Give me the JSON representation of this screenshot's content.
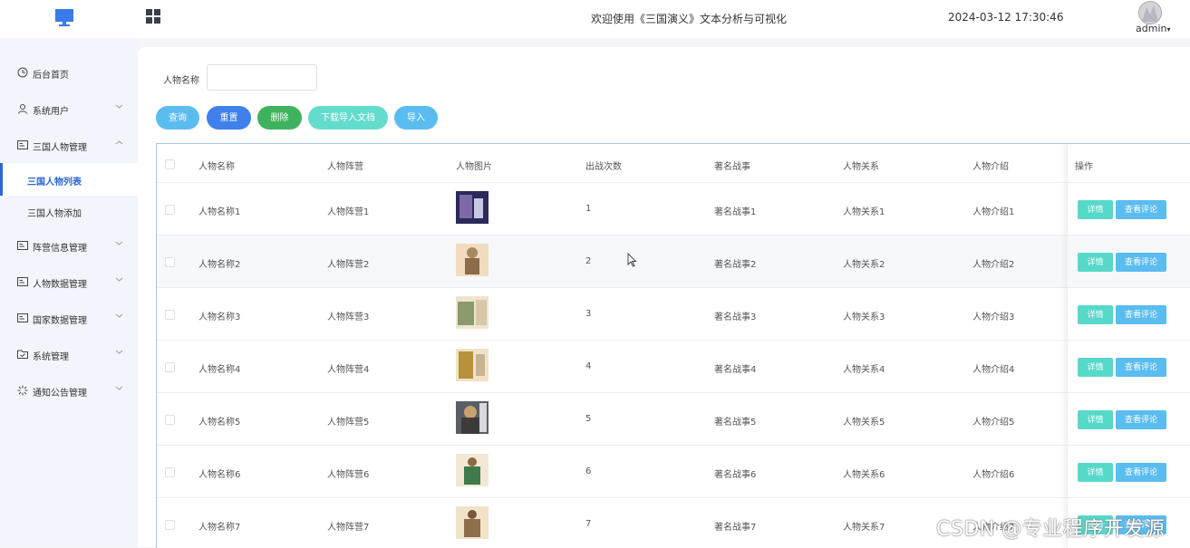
{
  "header": {
    "logo_icon": "monitor-icon",
    "menu_icon": "grid-icon",
    "title": "欢迎使用《三国演义》文本分析与可视化",
    "datetime": "2024-03-12 17:30:46",
    "user": "admin"
  },
  "sidebar": {
    "items": [
      {
        "label": "后台首页",
        "icon": "clock-icon"
      },
      {
        "label": "系统用户",
        "icon": "user-icon"
      },
      {
        "label": "三国人物管理",
        "icon": "card-icon"
      },
      {
        "label": "三国人物列表",
        "active": true
      },
      {
        "label": "三国人物添加"
      },
      {
        "label": "阵营信息管理",
        "icon": "card-icon"
      },
      {
        "label": "人物数据管理",
        "icon": "card-icon"
      },
      {
        "label": "国家数据管理",
        "icon": "card-icon"
      },
      {
        "label": "系统管理",
        "icon": "folder-icon"
      },
      {
        "label": "通知公告管理",
        "icon": "sparkle-icon"
      }
    ]
  },
  "search": {
    "label": "人物名称",
    "value": ""
  },
  "buttons": {
    "query": "查询",
    "reset": "重置",
    "delete": "删除",
    "download": "下载导入文档",
    "import": "导入"
  },
  "table": {
    "columns": [
      "人物名称",
      "人物阵营",
      "人物图片",
      "出战次数",
      "著名战事",
      "人物关系",
      "人物介绍",
      "操作"
    ],
    "action_detail": "详情",
    "action_review": "查看评论",
    "rows": [
      {
        "name": "人物名称1",
        "camp": "人物阵营1",
        "battles": "1",
        "war": "著名战事1",
        "relation": "人物关系1",
        "intro": "人物介绍1"
      },
      {
        "name": "人物名称2",
        "camp": "人物阵营2",
        "battles": "2",
        "war": "著名战事2",
        "relation": "人物关系2",
        "intro": "人物介绍2"
      },
      {
        "name": "人物名称3",
        "camp": "人物阵营3",
        "battles": "3",
        "war": "著名战事3",
        "relation": "人物关系3",
        "intro": "人物介绍3"
      },
      {
        "name": "人物名称4",
        "camp": "人物阵营4",
        "battles": "4",
        "war": "著名战事4",
        "relation": "人物关系4",
        "intro": "人物介绍4"
      },
      {
        "name": "人物名称5",
        "camp": "人物阵营5",
        "battles": "5",
        "war": "著名战事5",
        "relation": "人物关系5",
        "intro": "人物介绍5"
      },
      {
        "name": "人物名称6",
        "camp": "人物阵营6",
        "battles": "6",
        "war": "著名战事6",
        "relation": "人物关系6",
        "intro": "人物介绍6"
      },
      {
        "name": "人物名称7",
        "camp": "人物阵营7",
        "battles": "7",
        "war": "著名战事7",
        "relation": "人物关系7",
        "intro": "人物介绍7"
      }
    ]
  },
  "watermark": "CSDN @专业程序开发源",
  "colors": {
    "query": "#5bbcf0",
    "reset": "#3f80ea",
    "delete": "#3fb25d",
    "download": "#63dccd",
    "import": "#5bbcf0",
    "detail": "#57d9c9",
    "review": "#5bbcf0",
    "active_nav": "#2d66d8"
  }
}
